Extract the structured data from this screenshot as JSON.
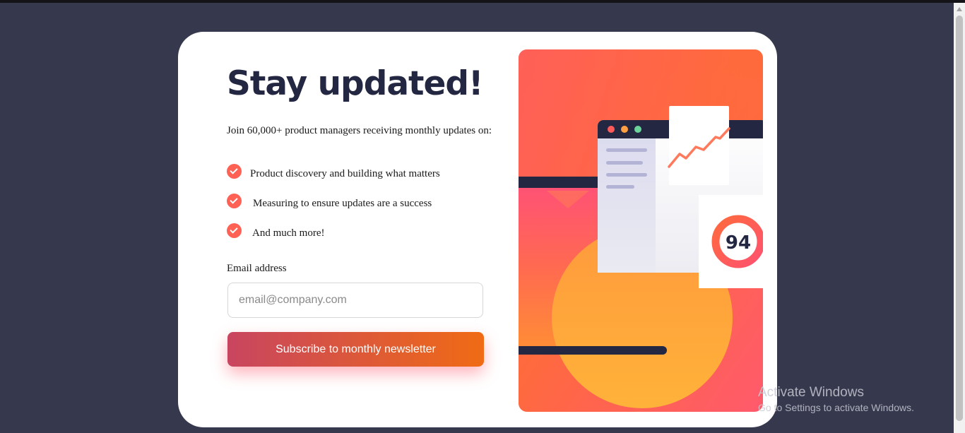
{
  "card": {
    "title": "Stay updated!",
    "intro": "Join 60,000+ product managers receiving monthly updates on:",
    "features": [
      {
        "text": "Product discovery and building what matters",
        "icon": "check-circle-icon"
      },
      {
        "text": "Measuring to ensure updates are a success",
        "icon": "check-circle-icon"
      },
      {
        "text": "And much more!",
        "icon": "check-circle-icon"
      }
    ],
    "email_label": "Email address",
    "email_value": "",
    "email_placeholder": "email@company.com",
    "subscribe_label": "Subscribe to monthly newsletter"
  },
  "illustration": {
    "score": "94"
  },
  "watermark": {
    "title": "Activate Windows",
    "subtitle": "Go to Settings to activate Windows."
  },
  "colors": {
    "background": "#36384d",
    "dark_navy": "#242742",
    "tomato": "#ff6155",
    "button_gradient_start": "#c84560",
    "button_gradient_end": "#f06b14"
  }
}
